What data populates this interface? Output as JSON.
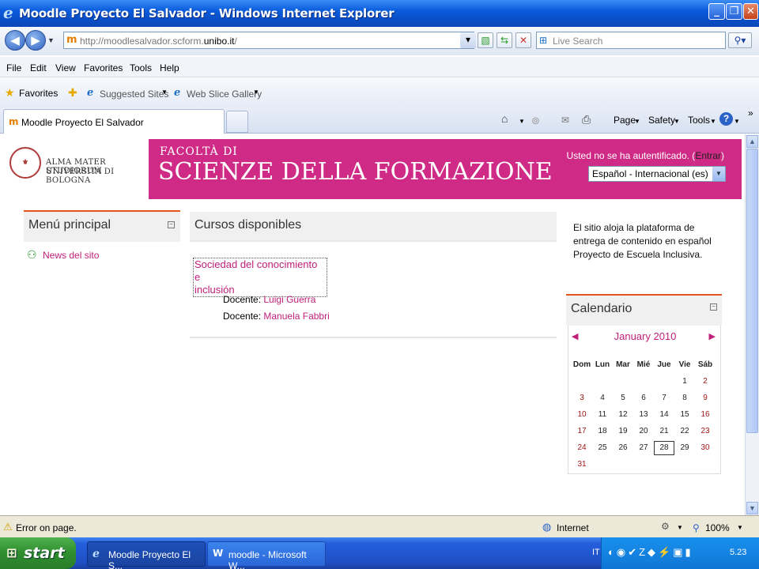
{
  "window": {
    "title": "Moodle Proyecto El Salvador - Windows Internet Explorer"
  },
  "address": {
    "url_prefix": "http://moodlesalvador.scform.",
    "url_domain": "unibo.it",
    "url_suffix": "/",
    "search_placeholder": "Live Search"
  },
  "menu": [
    "File",
    "Edit",
    "View",
    "Favorites",
    "Tools",
    "Help"
  ],
  "favorites": {
    "label": "Favorites",
    "suggested": "Suggested Sites",
    "webslice": "Web Slice Gallery"
  },
  "tab": {
    "label": "Moodle Proyecto El Salvador"
  },
  "commands": {
    "page": "Page",
    "safety": "Safety",
    "tools": "Tools"
  },
  "header": {
    "uni_line1": "ALMA MATER STUDIORUM",
    "uni_line2": "UNIVERSITÀ DI BOLOGNA",
    "faculty_small": "FACOLTÀ DI",
    "faculty_big": "SCIENZE DELLA FORMAZIONE",
    "auth_text": "Usted no se ha autentificado. (",
    "login_link": "Entrar",
    "auth_close": ")",
    "language": "Español - Internacional (es)"
  },
  "main_menu": {
    "title": "Menú principal",
    "items": [
      {
        "label": "News del sito"
      }
    ]
  },
  "courses": {
    "title": "Cursos disponibles",
    "list": [
      {
        "name_line1": "Sociedad del conocimiento e",
        "name_line2": "inclusión",
        "teachers": [
          {
            "role": "Docente:",
            "name": "Luigi Guerra"
          },
          {
            "role": "Docente:",
            "name": "Manuela Fabbri"
          }
        ]
      }
    ]
  },
  "site_summary": {
    "line1": "El sitio aloja la plataforma de",
    "line2": "entrega de contenido en español",
    "line3": "Proyecto de Escuela Inclusiva."
  },
  "calendar": {
    "title": "Calendario",
    "month": "January 2010",
    "weekdays": [
      "Dom",
      "Lun",
      "Mar",
      "Mié",
      "Jue",
      "Vie",
      "Sáb"
    ],
    "first_weekday_index": 5,
    "days_in_month": 31,
    "today": 28
  },
  "status": {
    "message": "Error on page.",
    "zone": "Internet",
    "zoom": "100%"
  },
  "taskbar": {
    "start": "start",
    "tasks": [
      {
        "label": "Moodle Proyecto El S..."
      },
      {
        "label": "moodle - Microsoft W..."
      }
    ],
    "lang": "IT",
    "time": "5.23"
  },
  "colors": {
    "brand_pink": "#cf2a86",
    "link": "#c0207a",
    "block_accent": "#e4561f"
  }
}
